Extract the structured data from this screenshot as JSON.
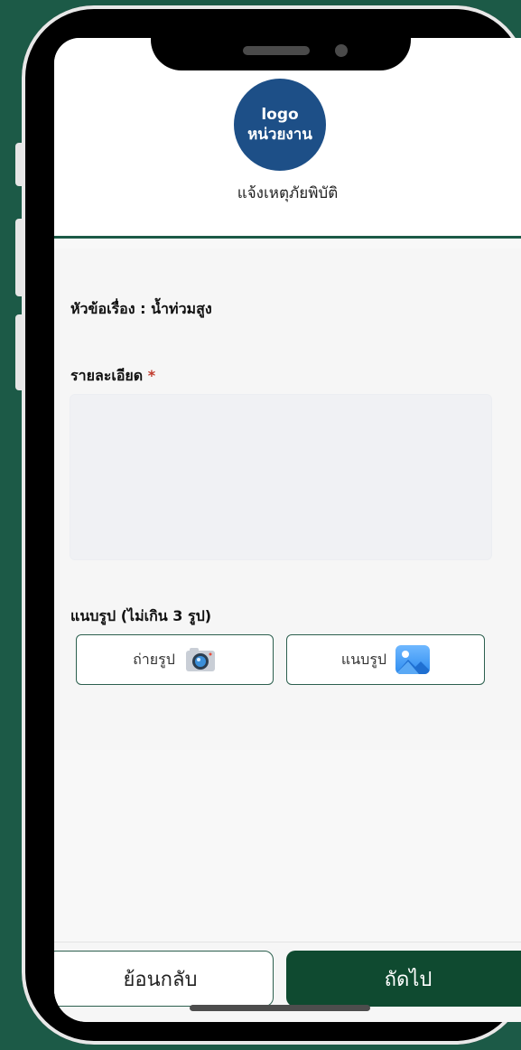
{
  "logo": {
    "line1": "logo",
    "line2": "หน่วยงาน"
  },
  "header": {
    "title": "แจ้งเหตุภัยพิบัติ"
  },
  "form": {
    "subject_label": "หัวข้อเรื่อง : น้ำท่วมสูง",
    "detail_label": "รายละเอียด",
    "required_mark": "*",
    "detail_value": "",
    "attach_label": "แนบรูป (ไม่เกิน 3 รูป)",
    "take_photo_label": "ถ่ายรูป",
    "attach_photo_label": "แนบรูป"
  },
  "footer": {
    "back_label": "ย้อนกลับ",
    "next_label": "ถัดไป"
  },
  "colors": {
    "background": "#1c5a47",
    "primary": "#0f4a30",
    "logo": "#1d4f87",
    "required": "#c0392b"
  },
  "icons": {
    "camera": "camera-icon",
    "image": "image-icon"
  }
}
